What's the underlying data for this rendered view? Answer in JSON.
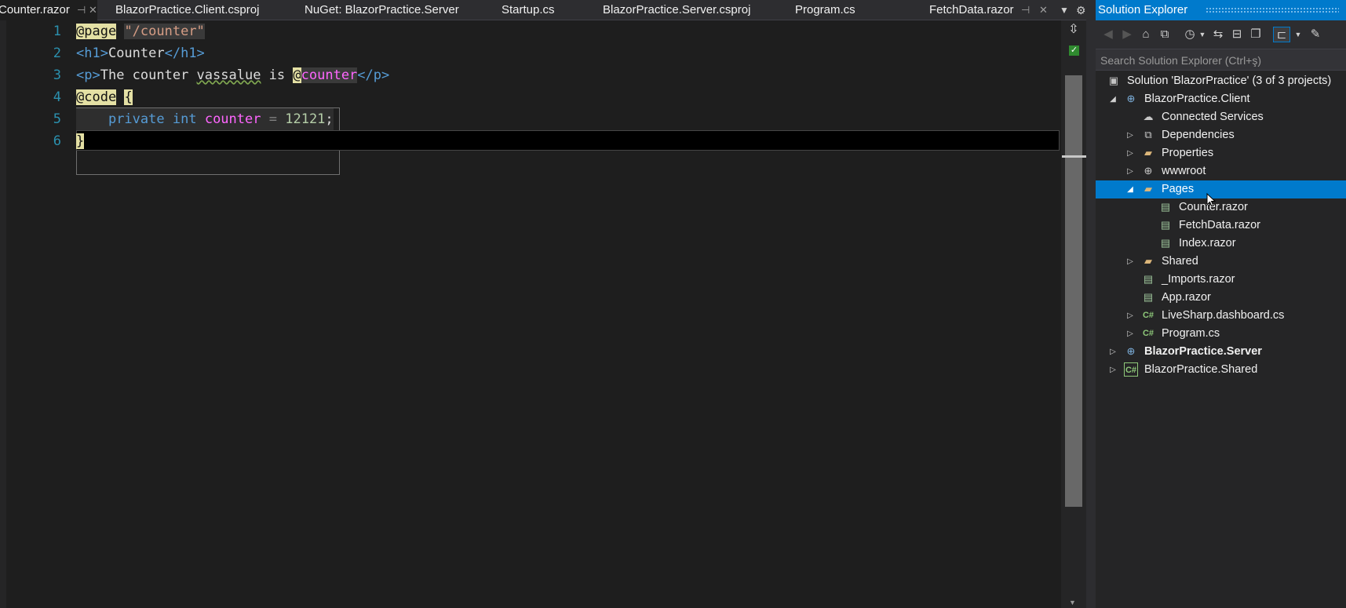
{
  "tabs": [
    {
      "label": "Counter.razor",
      "active": true,
      "pinned": true
    },
    {
      "label": "BlazorPractice.Client.csproj"
    },
    {
      "label": "NuGet: BlazorPractice.Server"
    },
    {
      "label": "Startup.cs"
    },
    {
      "label": "BlazorPractice.Server.csproj"
    },
    {
      "label": "Program.cs"
    },
    {
      "label": "FetchData.razor"
    }
  ],
  "editor": {
    "line_numbers": [
      "1",
      "2",
      "3",
      "4",
      "5",
      "6"
    ],
    "lines": {
      "l1": {
        "directive": "@page",
        "string": "\"/counter\""
      },
      "l2": {
        "open_tag": "<h1>",
        "text": "Counter",
        "close_tag": "</h1>"
      },
      "l3": {
        "open_tag": "<p>",
        "text_a": "The counter ",
        "typo": "vassalue",
        "text_b": " is ",
        "at": "@",
        "var": "counter",
        "close_tag": "</p>"
      },
      "l4": {
        "directive": "@code",
        "brace": "{"
      },
      "l5": {
        "kw1": "private",
        "kw2": "int",
        "var": "counter",
        "eq": "=",
        "num": "12121",
        "semi": ";"
      },
      "l6": {
        "brace": "}"
      }
    }
  },
  "solution_explorer": {
    "title": "Solution Explorer",
    "search_placeholder": "Search Solution Explorer (Ctrl+ş)",
    "tree": [
      {
        "label": "Solution 'BlazorPractice' (3 of 3 projects)",
        "icon": "solution-icon"
      },
      {
        "label": "BlazorPractice.Client",
        "icon": "web-project-icon",
        "expanded": true
      },
      {
        "label": "Connected Services",
        "icon": "connected-services-icon"
      },
      {
        "label": "Dependencies",
        "icon": "dependencies-icon"
      },
      {
        "label": "Properties",
        "icon": "properties-icon"
      },
      {
        "label": "wwwroot",
        "icon": "globe-icon"
      },
      {
        "label": "Pages",
        "icon": "folder-open-icon",
        "expanded": true,
        "selected": true
      },
      {
        "label": "Counter.razor",
        "icon": "razor-file-icon"
      },
      {
        "label": "FetchData.razor",
        "icon": "razor-file-icon"
      },
      {
        "label": "Index.razor",
        "icon": "razor-file-icon"
      },
      {
        "label": "Shared",
        "icon": "folder-icon"
      },
      {
        "label": "_Imports.razor",
        "icon": "razor-file-icon"
      },
      {
        "label": "App.razor",
        "icon": "razor-file-icon"
      },
      {
        "label": "LiveSharp.dashboard.cs",
        "icon": "csharp-file-icon"
      },
      {
        "label": "Program.cs",
        "icon": "csharp-file-icon"
      },
      {
        "label": "BlazorPractice.Server",
        "icon": "web-project-icon",
        "bold": true
      },
      {
        "label": "BlazorPractice.Shared",
        "icon": "csharp-project-icon"
      }
    ]
  },
  "colors": {
    "accent": "#007acc",
    "editor_bg": "#1e1e1e",
    "directive_highlight": "#e4e0a4",
    "variable": "#ff66ff",
    "keyword": "#569cd6"
  }
}
